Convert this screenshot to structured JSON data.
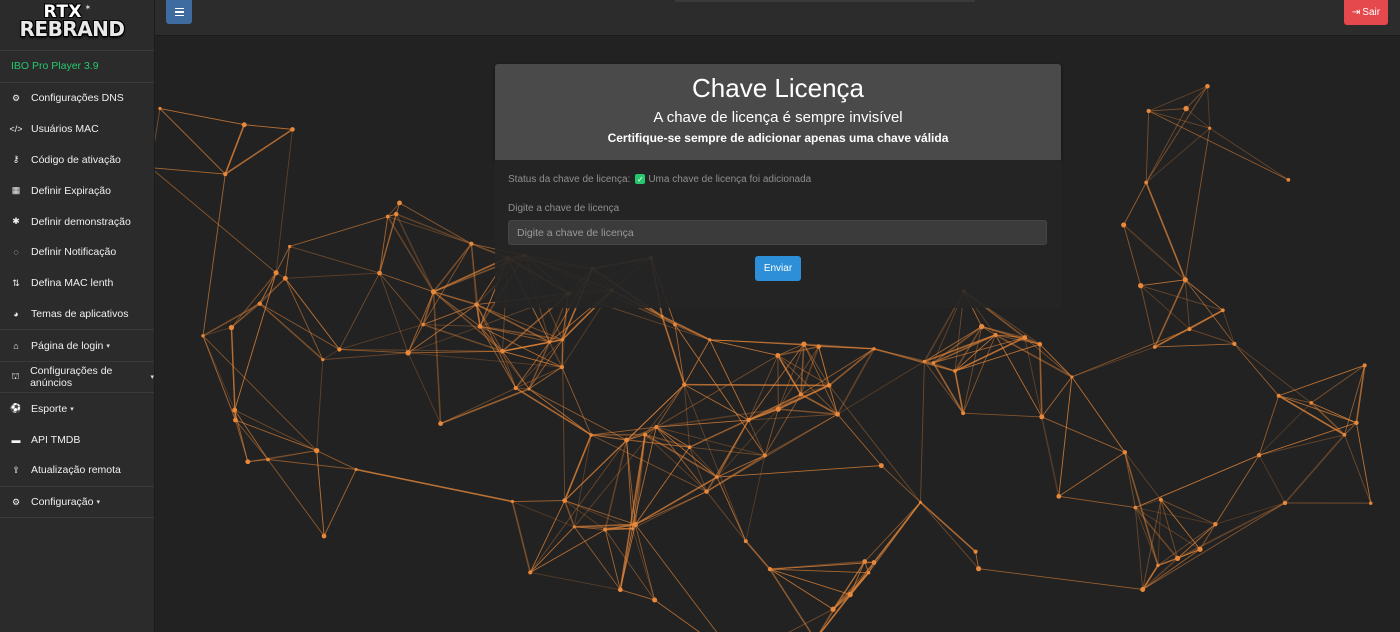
{
  "brand": {
    "logo_top": "RTX",
    "logo_bottom": "REBRAND",
    "logo_spark": "✶"
  },
  "sidebar": {
    "version": "IBO Pro Player 3.9",
    "items": [
      {
        "label": "Configurações DNS",
        "icon": "cogs-icon",
        "glyph": "⚙",
        "has_caret": false
      },
      {
        "label": "Usuários MAC",
        "icon": "code-icon",
        "glyph": "</>",
        "has_caret": false
      },
      {
        "label": "Código de ativação",
        "icon": "key-icon",
        "glyph": "⚷",
        "has_caret": false
      },
      {
        "label": "Definir Expiração",
        "icon": "calendar-icon",
        "glyph": "▦",
        "has_caret": false
      },
      {
        "label": "Definir demonstração",
        "icon": "asterisk-icon",
        "glyph": "✱",
        "has_caret": false
      },
      {
        "label": "Definir Notificação",
        "icon": "comment-icon",
        "glyph": "◌",
        "has_caret": false
      },
      {
        "label": "Defina MAC lenth",
        "icon": "sort-icon",
        "glyph": "⇅",
        "has_caret": false
      },
      {
        "label": "Temas de aplicativos",
        "icon": "palette-icon",
        "glyph": "◕",
        "has_caret": false
      }
    ],
    "groups": [
      {
        "label": "Página de login",
        "icon": "bank-icon",
        "glyph": "⌂",
        "has_caret": true
      },
      {
        "label": "Configurações de anúncios",
        "icon": "binoculars-icon",
        "glyph": "⛫",
        "has_caret": true
      }
    ],
    "items2": [
      {
        "label": "Esporte",
        "icon": "soccer-ball-icon",
        "glyph": "⚽",
        "has_caret": true
      },
      {
        "label": "API TMDB",
        "icon": "film-icon",
        "glyph": "▬",
        "has_caret": false
      },
      {
        "label": "Atualização remota",
        "icon": "upload-icon",
        "glyph": "⇪",
        "has_caret": false
      }
    ],
    "settings": {
      "label": "Configuração",
      "icon": "gear-icon",
      "glyph": "⚙",
      "has_caret": true
    },
    "caret_glyph": "▾"
  },
  "topbar": {
    "logout_label": "Sair",
    "logout_icon": "sign-out-icon"
  },
  "card": {
    "title": "Chave Licença",
    "subtitle": "A chave de licença é sempre invisível",
    "note": "Certifique-se sempre de adicionar apenas uma chave válida",
    "status_label": "Status da chave de licença:",
    "status_value": "Uma chave de licença foi adicionada",
    "input_label": "Digite a chave de licença",
    "input_placeholder": "Digite a chave de licença",
    "submit_label": "Enviar"
  },
  "colors": {
    "accent_green": "#28c76f",
    "logout_red": "#e5484d",
    "submit_blue": "#2d8fd8",
    "network_orange": "#e8883a"
  }
}
